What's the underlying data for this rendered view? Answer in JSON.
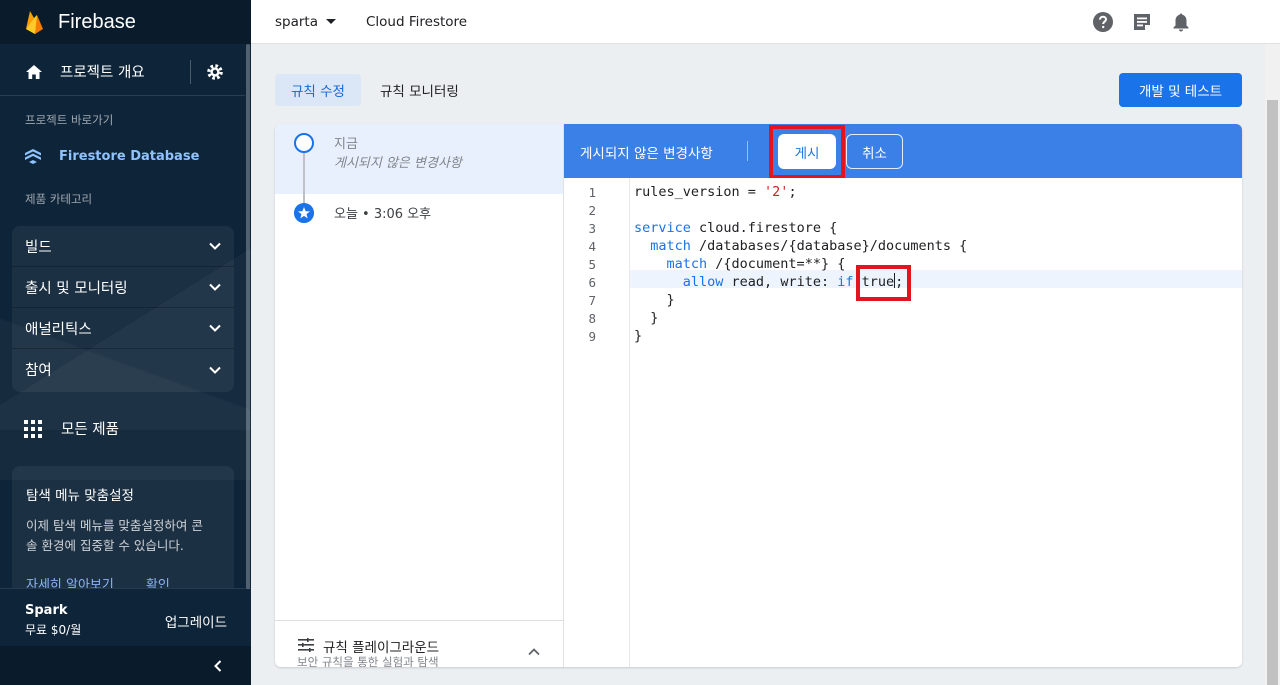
{
  "sidebar": {
    "brand": "Firebase",
    "overview_label": "프로젝트 개요",
    "shortcuts_title": "프로젝트 바로가기",
    "firestore_label": "Firestore Database",
    "categories_title": "제품 카테고리",
    "categories": [
      {
        "label": "빌드"
      },
      {
        "label": "출시 및 모니터링"
      },
      {
        "label": "애널리틱스"
      },
      {
        "label": "참여"
      }
    ],
    "all_products_label": "모든 제품",
    "promo": {
      "title": "탐색 메뉴 맞춤설정",
      "body_line1": "이제 탐색 메뉴를 맞춤설정하여 콘",
      "body_line2": "솔 환경에 집중할 수 있습니다.",
      "learn_more": "자세히 알아보기",
      "confirm": "확인"
    },
    "plan": {
      "name": "Spark",
      "price": "무료 $0/월",
      "upgrade_label": "업그레이드"
    }
  },
  "header": {
    "project": "sparta",
    "product": "Cloud Firestore"
  },
  "tabs": {
    "edit_rules": "규칙 수정",
    "monitor_rules": "규칙 모니터링"
  },
  "dev_test_button": "개발 및 테스트",
  "history": {
    "now_title": "지금",
    "now_subtitle": "게시되지 않은 변경사항",
    "today": "오늘 • 3:06 오후"
  },
  "playground": {
    "title": "규칙 플레이그라운드",
    "subtitle": "보안 규칙을 통한 실험과 탐색"
  },
  "banner": {
    "text": "게시되지 않은 변경사항",
    "publish_label": "게시",
    "cancel_label": "취소"
  },
  "editor": {
    "line_numbers": [
      "1",
      "2",
      "3",
      "4",
      "5",
      "6",
      "7",
      "8",
      "9"
    ],
    "lines": {
      "l1_a": "rules_version = ",
      "l1_b": "'2'",
      "l1_c": ";",
      "l3_a": "service",
      "l3_b": " cloud.firestore {",
      "l4_indent": "  ",
      "l4_a": "match",
      "l4_b": " /databases/{database}/documents {",
      "l5_indent": "    ",
      "l5_a": "match",
      "l5_b": " /{document=**} {",
      "l6_indent": "      ",
      "l6_a": "allow",
      "l6_b": " read, write: ",
      "l6_c": "if",
      "l6_d": " true",
      "l6_e": ";",
      "l7": "    }",
      "l8": "  }",
      "l9": "}"
    }
  },
  "colors": {
    "sidebar_bg": "#0e2438",
    "accent_blue": "#1a73e8",
    "banner_blue": "#3b80e6",
    "highlight_red": "#e3141d"
  }
}
